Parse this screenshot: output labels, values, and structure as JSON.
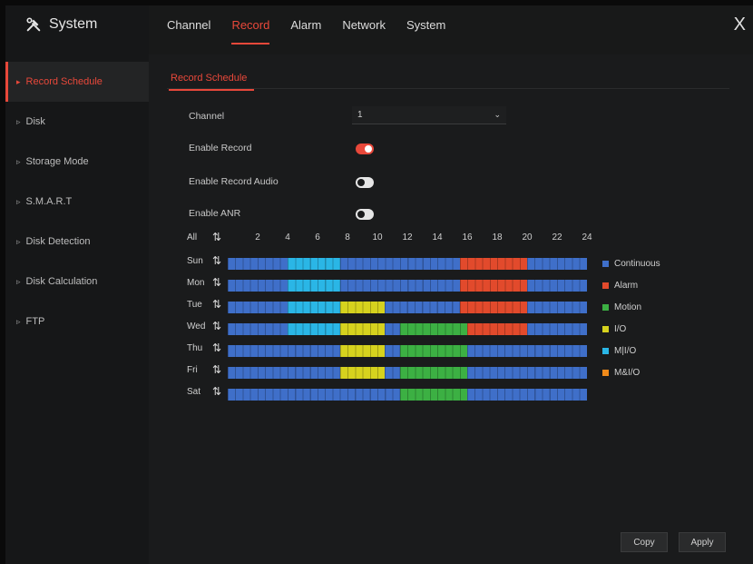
{
  "window": {
    "title": "System",
    "close_label": "X"
  },
  "top_tabs": [
    "Channel",
    "Record",
    "Alarm",
    "Network",
    "System"
  ],
  "active_tab": "Record",
  "sidebar": {
    "items": [
      "Record Schedule",
      "Disk",
      "Storage Mode",
      "S.M.A.R.T",
      "Disk Detection",
      "Disk Calculation",
      "FTP"
    ],
    "active": "Record Schedule"
  },
  "subtab": "Record Schedule",
  "form": {
    "channel_label": "Channel",
    "channel_value": "1",
    "enable_record_label": "Enable Record",
    "enable_record": true,
    "enable_audio_label": "Enable Record Audio",
    "enable_audio": false,
    "enable_anr_label": "Enable ANR",
    "enable_anr": false
  },
  "schedule": {
    "all_label": "All",
    "hours": [
      "2",
      "4",
      "6",
      "8",
      "10",
      "12",
      "14",
      "16",
      "18",
      "20",
      "22",
      "24"
    ],
    "days": [
      {
        "label": "Sun",
        "segments": [
          [
            0,
            8,
            "continuous"
          ],
          [
            8,
            15,
            "mio"
          ],
          [
            15,
            31,
            "continuous"
          ],
          [
            31,
            40,
            "alarm"
          ],
          [
            40,
            48,
            "continuous"
          ]
        ]
      },
      {
        "label": "Mon",
        "segments": [
          [
            0,
            8,
            "continuous"
          ],
          [
            8,
            15,
            "mio"
          ],
          [
            15,
            31,
            "continuous"
          ],
          [
            31,
            40,
            "alarm"
          ],
          [
            40,
            48,
            "continuous"
          ]
        ]
      },
      {
        "label": "Tue",
        "segments": [
          [
            0,
            8,
            "continuous"
          ],
          [
            8,
            15,
            "mio"
          ],
          [
            15,
            21,
            "io"
          ],
          [
            21,
            31,
            "continuous"
          ],
          [
            31,
            40,
            "alarm"
          ],
          [
            40,
            48,
            "continuous"
          ]
        ]
      },
      {
        "label": "Wed",
        "segments": [
          [
            0,
            8,
            "continuous"
          ],
          [
            8,
            15,
            "mio"
          ],
          [
            15,
            21,
            "io"
          ],
          [
            21,
            23,
            "continuous"
          ],
          [
            23,
            32,
            "motion"
          ],
          [
            32,
            40,
            "alarm"
          ],
          [
            40,
            48,
            "continuous"
          ]
        ]
      },
      {
        "label": "Thu",
        "segments": [
          [
            0,
            15,
            "continuous"
          ],
          [
            15,
            21,
            "io"
          ],
          [
            21,
            23,
            "continuous"
          ],
          [
            23,
            32,
            "motion"
          ],
          [
            32,
            48,
            "continuous"
          ]
        ]
      },
      {
        "label": "Fri",
        "segments": [
          [
            0,
            15,
            "continuous"
          ],
          [
            15,
            21,
            "io"
          ],
          [
            21,
            23,
            "continuous"
          ],
          [
            23,
            32,
            "motion"
          ],
          [
            32,
            48,
            "continuous"
          ]
        ]
      },
      {
        "label": "Sat",
        "segments": [
          [
            0,
            23,
            "continuous"
          ],
          [
            23,
            32,
            "motion"
          ],
          [
            32,
            48,
            "continuous"
          ]
        ]
      }
    ]
  },
  "legend": [
    {
      "key": "continuous",
      "label": "Continuous",
      "color": "#3f6fc9"
    },
    {
      "key": "alarm",
      "label": "Alarm",
      "color": "#e24a2c"
    },
    {
      "key": "motion",
      "label": "Motion",
      "color": "#3cb043"
    },
    {
      "key": "io",
      "label": "I/O",
      "color": "#d6d21e"
    },
    {
      "key": "mio",
      "label": "M|I/O",
      "color": "#2ab6e6"
    },
    {
      "key": "maio",
      "label": "M&I/O",
      "color": "#f08a1a"
    }
  ],
  "buttons": {
    "copy": "Copy",
    "apply": "Apply"
  },
  "colors": {
    "accent": "#e8483a"
  }
}
